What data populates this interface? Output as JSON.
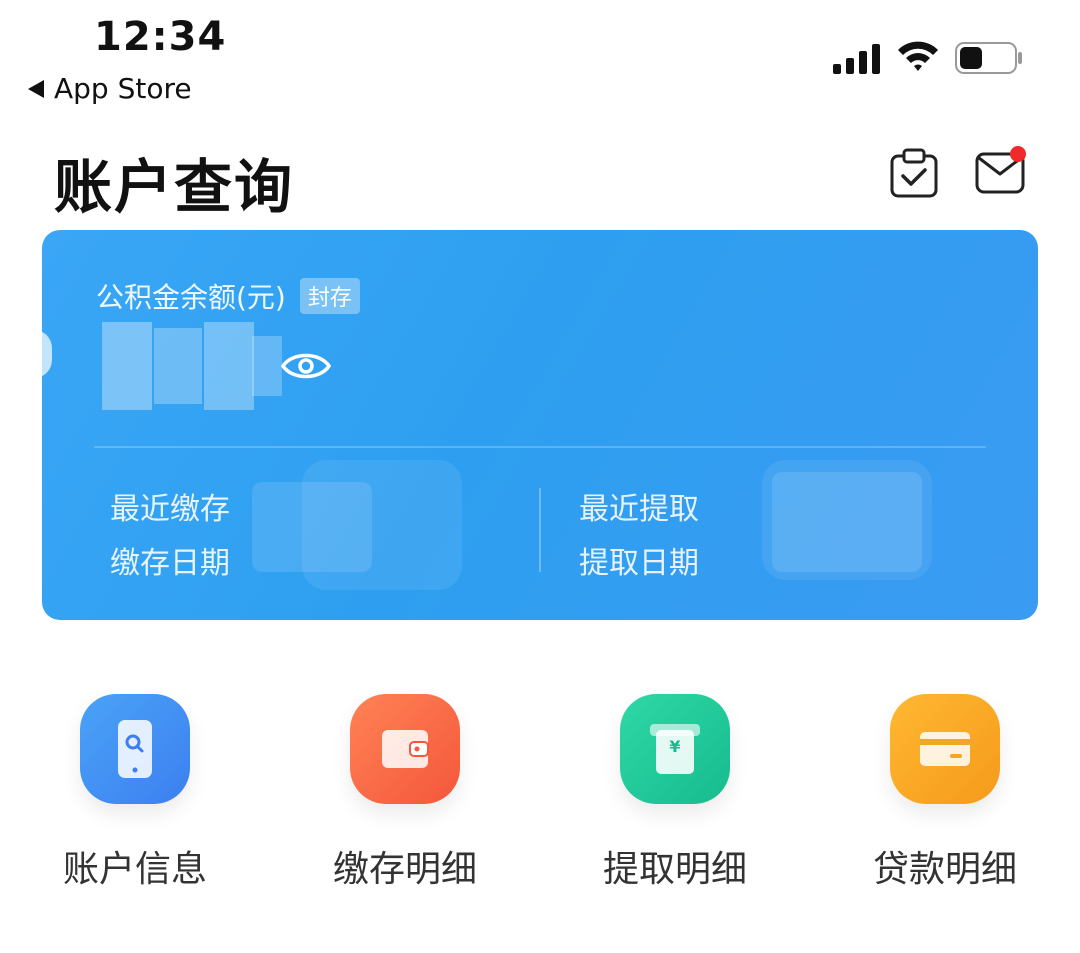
{
  "status_bar": {
    "time": "12:34",
    "back_label": "App Store"
  },
  "header": {
    "title": "账户查询",
    "icons": [
      "clipboard-check-icon",
      "mail-icon"
    ]
  },
  "balance_card": {
    "balance_label": "公积金余额(元)",
    "badge": "封存",
    "recent_deposit_label": "最近缴存",
    "deposit_date_label": "缴存日期",
    "recent_withdraw_label": "最近提取",
    "withdraw_date_label": "提取日期"
  },
  "menu": {
    "items": [
      {
        "label": "账户信息",
        "icon": "phone-search-icon",
        "color": "#3d8df2"
      },
      {
        "label": "缴存明细",
        "icon": "wallet-icon",
        "color": "#fb6a45"
      },
      {
        "label": "提取明细",
        "icon": "yuan-receipt-icon",
        "color": "#1fc99a"
      },
      {
        "label": "贷款明细",
        "icon": "card-icon",
        "color": "#f9a825"
      }
    ]
  }
}
